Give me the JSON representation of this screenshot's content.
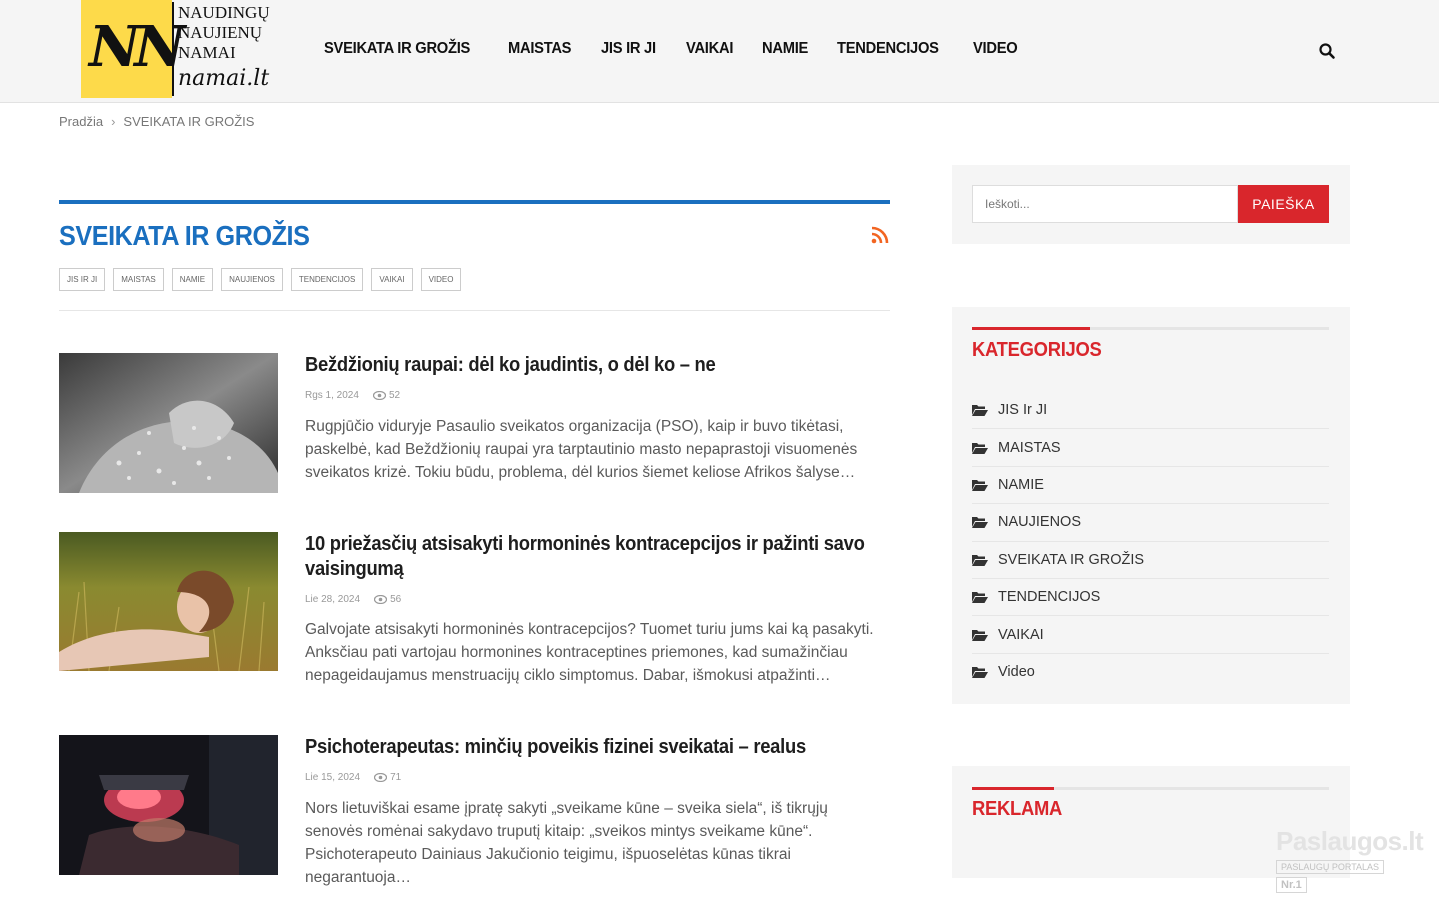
{
  "header": {
    "logo": {
      "monogram": "NN",
      "lines": [
        "NAUDINGŲ",
        "NAUJIENŲ",
        "NAMAI"
      ],
      "signature": "namai.lt"
    },
    "nav": [
      "SVEIKATA IR GROŽIS",
      "MAISTAS",
      "JIS IR JI",
      "VAIKAI",
      "NAMIE",
      "TENDENCIJOS",
      "VIDEO"
    ]
  },
  "breadcrumb": {
    "home": "Pradžia",
    "current": "SVEIKATA IR GROŽIS"
  },
  "category": {
    "title": "SVEIKATA IR GROŽIS",
    "tags": [
      "JIS IR JI",
      "MAISTAS",
      "NAMIE",
      "NAUJIENOS",
      "TENDENCIJOS",
      "VAIKAI",
      "VIDEO"
    ],
    "accent": "#1a6fbf"
  },
  "posts": [
    {
      "title": "Beždžionių raupai: dėl ko jaudintis, o dėl ko – ne",
      "date": "Rgs 1, 2024",
      "views": "52",
      "excerpt": "Rugpjūčio viduryje Pasaulio sveikatos organizacija (PSO), kaip ir buvo tikėtasi, paskelbė, kad Beždžionių raupai yra tarptautinio masto nepaprastoji visuomenės sveikatos krizė. Tokiu būdu, problema, dėl kurios šiemet keliose Afrikos šalyse…"
    },
    {
      "title": "10 priežasčių atsisakyti hormoninės kontracepcijos ir pažinti savo vaisingumą",
      "date": "Lie 28, 2024",
      "views": "56",
      "excerpt": "Galvojate atsisakyti hormoninės kontracepcijos? Tuomet turiu jums kai ką pasakyti. Anksčiau pati vartojau hormonines kontraceptines priemones, kad sumažinčiau nepageidaujamus menstruacijų ciklo simptomus. Dabar, išmokusi atpažinti…"
    },
    {
      "title": "Psichoterapeutas: minčių poveikis fizinei sveikatai – realus",
      "date": "Lie 15, 2024",
      "views": "71",
      "excerpt": "Nors lietuviškai esame įpratę sakyti „sveikame kūne – sveika siela“, iš tikrųjų senovės romėnai sakydavo truputį kitaip: „sveikos mintys sveikame kūne“. Psichoterapeuto Dainiaus Jakučionio teigimu, išpuoselėtas kūnas tikrai negarantuoja…"
    }
  ],
  "sidebar": {
    "search": {
      "placeholder": "Ieškoti...",
      "button": "PAIEŠKA"
    },
    "categories_title": "KATEGORIJOS",
    "categories": [
      "JIS Ir JI",
      "MAISTAS",
      "NAMIE",
      "NAUJIENOS",
      "SVEIKATA IR GROŽIS",
      "TENDENCIJOS",
      "VAIKAI",
      "Video"
    ],
    "ad_title": "REKLAMA",
    "accent": "#d9262c"
  },
  "watermark": {
    "main": "Paslaugos.lt",
    "sub": "PASLAUGŲ PORTALAS",
    "rank": "Nr.1"
  }
}
